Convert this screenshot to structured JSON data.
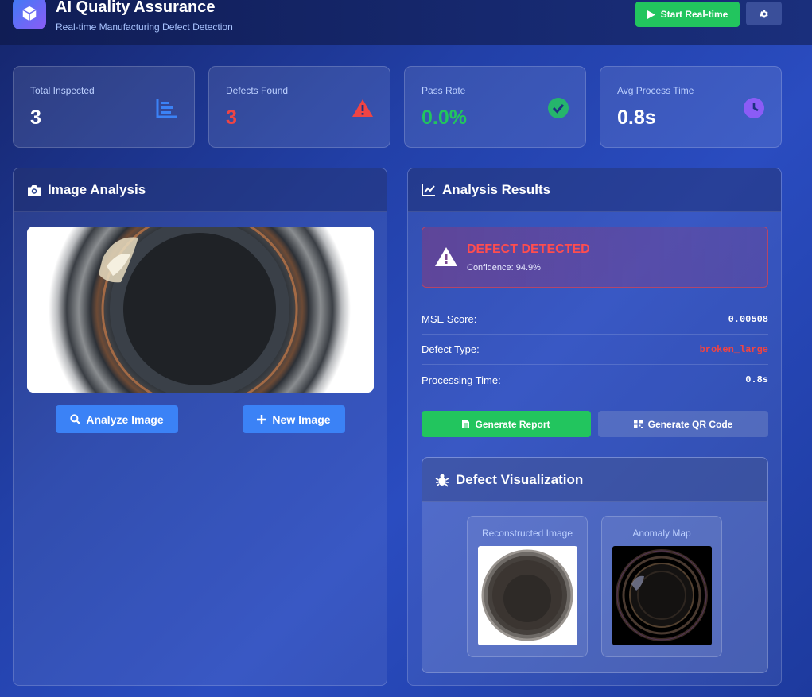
{
  "header": {
    "title": "AI Quality Assurance",
    "subtitle": "Real-time Manufacturing Defect Detection",
    "start_label": "Start Real-time"
  },
  "stats": [
    {
      "label": "Total Inspected",
      "value": "3",
      "color": "#ffffff",
      "icon": "bar-chart-icon"
    },
    {
      "label": "Defects Found",
      "value": "3",
      "color": "#ef4444",
      "icon": "warning-icon"
    },
    {
      "label": "Pass Rate",
      "value": "0.0%",
      "color": "#22c55e",
      "icon": "check-circle-icon"
    },
    {
      "label": "Avg Process Time",
      "value": "0.8s",
      "color": "#ffffff",
      "icon": "clock-icon"
    }
  ],
  "analysis": {
    "title": "Image Analysis",
    "analyze_label": "Analyze Image",
    "new_label": "New Image"
  },
  "results": {
    "title": "Analysis Results",
    "alert_title": "DEFECT DETECTED",
    "alert_confidence": "Confidence: 94.9%",
    "metrics": [
      {
        "label": "MSE Score:",
        "value": "0.00508",
        "color": "#ffffff"
      },
      {
        "label": "Defect Type:",
        "value": "broken_large",
        "color": "#ef4444"
      },
      {
        "label": "Processing Time:",
        "value": "0.8s",
        "color": "#ffffff"
      }
    ],
    "report_label": "Generate Report",
    "qr_label": "Generate QR Code"
  },
  "visualization": {
    "title": "Defect Visualization",
    "reconstructed_label": "Reconstructed Image",
    "anomaly_label": "Anomaly Map"
  }
}
